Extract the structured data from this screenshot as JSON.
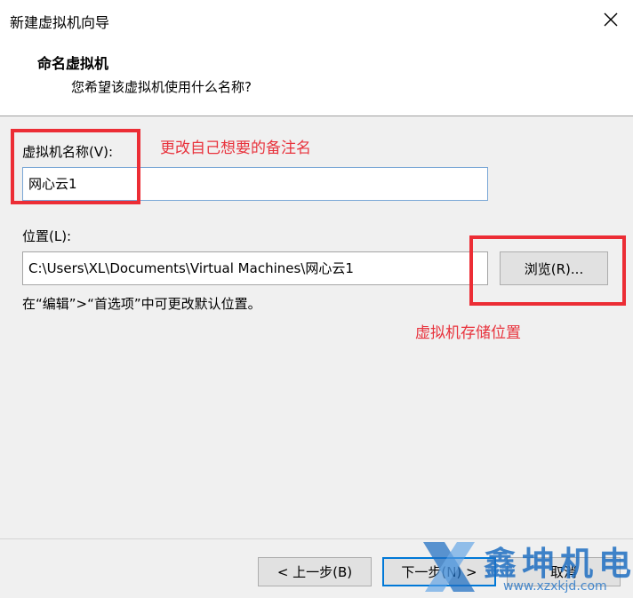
{
  "window": {
    "title": "新建虚拟机向导",
    "close_icon": "close-icon"
  },
  "header": {
    "title": "命名虚拟机",
    "subtitle": "您希望该虚拟机使用什么名称?"
  },
  "form": {
    "vm_name_label": "虚拟机名称(V):",
    "vm_name_value": "网心云1",
    "location_label": "位置(L):",
    "location_value": "C:\\Users\\XL\\Documents\\Virtual Machines\\网心云1",
    "browse_label": "浏览(R)...",
    "hint": "在“编辑”>“首选项”中可更改默认位置。"
  },
  "annotations": {
    "name_note": "更改自己想要的备注名",
    "location_note": "虚拟机存储位置",
    "color": "#ec2d35"
  },
  "buttons": {
    "back": "< 上一步(B)",
    "next": "下一步(N) >",
    "cancel": "取消"
  },
  "watermark": {
    "brand": "鑫坤机电",
    "url": "www.xzxkjd.com"
  }
}
